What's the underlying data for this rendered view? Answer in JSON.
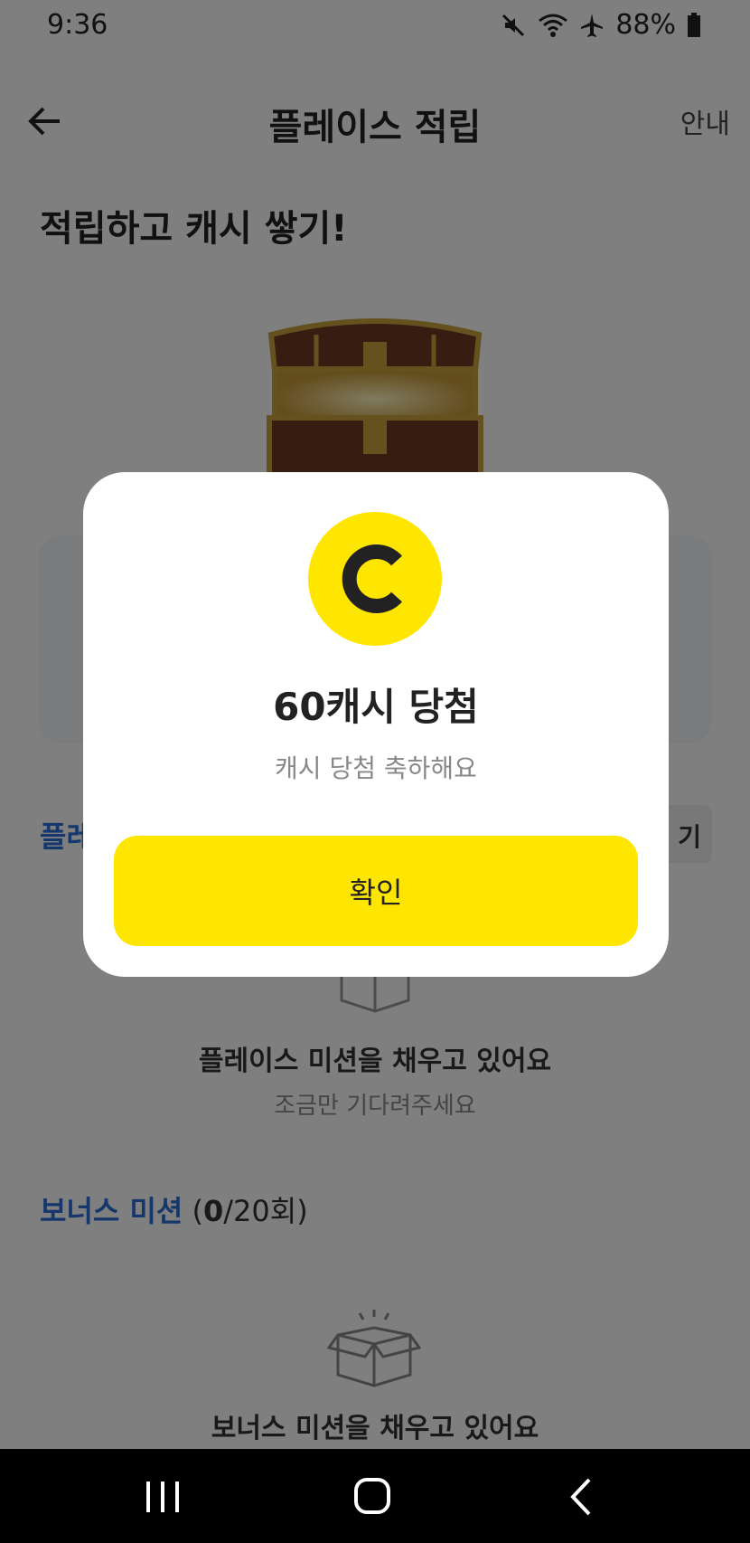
{
  "status_bar": {
    "time": "9:36",
    "battery": "88%",
    "icons": [
      "mute-icon",
      "wifi-icon",
      "airplane-icon",
      "battery-icon"
    ]
  },
  "app_bar": {
    "title": "플레이스 적립",
    "info": "안내",
    "back_icon": "back-arrow-icon"
  },
  "headline": "적립하고 캐시 쌓기!",
  "section_1": {
    "title_partial": "플레",
    "chip_partial": "기"
  },
  "place_mission_empty": {
    "title": "플레이스 미션을 채우고 있어요",
    "subtitle": "조금만 기다려주세요"
  },
  "bonus": {
    "title": "보너스 미션",
    "count_open": "(",
    "count_current": "0",
    "count_rest": "/20회)"
  },
  "bonus_empty": {
    "title": "보너스 미션을 채우고 있어요"
  },
  "dialog": {
    "coin_letter": "C",
    "title": "60캐시 당첨",
    "subtitle": "캐시 당첨 축하해요",
    "confirm": "확인"
  },
  "colors": {
    "accent_yellow": "#ffe600",
    "accent_blue": "#2a6fd6",
    "dim": "rgba(0,0,0,0.5)"
  },
  "nav": {
    "recents_icon": "recents-icon",
    "home_icon": "home-icon",
    "back_icon": "nav-back-icon"
  }
}
